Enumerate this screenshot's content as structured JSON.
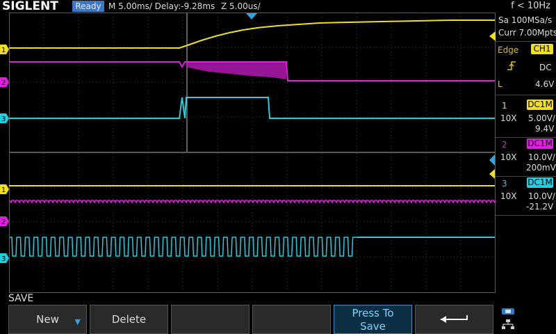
{
  "header": {
    "brand": "SIGLENT",
    "status": "Ready",
    "timebase": "M 5.00ms/ Delay:-9.28ms",
    "zoom": "Z 5.00us/",
    "freq": "f < 10Hz"
  },
  "acquisition": {
    "sample_rate": "Sa 100MSa/s",
    "memory": "Curr 7.00Mpts"
  },
  "trigger": {
    "type": "Edge",
    "source": "CH1",
    "coupling": "DC",
    "level_label": "L",
    "level": "4.6V"
  },
  "channels": [
    {
      "num": "1",
      "coupling": "DC1M",
      "probe": "10X",
      "scale": "5.00V/",
      "offset": "9.4V",
      "color": "#f0e020"
    },
    {
      "num": "2",
      "coupling": "DC1M",
      "probe": "10X",
      "scale": "10.0V/",
      "offset": "200mV",
      "color": "#e020e0"
    },
    {
      "num": "3",
      "coupling": "DC1M",
      "probe": "10X",
      "scale": "10.0V/",
      "offset": "-21.2V",
      "color": "#20d0e0"
    }
  ],
  "channel_markers": [
    "1",
    "2",
    "3"
  ],
  "menu": {
    "title": "SAVE",
    "new_label": "New",
    "delete_label": "Delete",
    "press_to_save": "Press To Save",
    "back_icon": "return-arrow-icon",
    "usb_icon": "usb-network-icon"
  },
  "colors": {
    "ch1": "#f0e020",
    "ch2": "#e020e0",
    "ch3": "#20d0e0",
    "accent": "#3a78c8"
  }
}
